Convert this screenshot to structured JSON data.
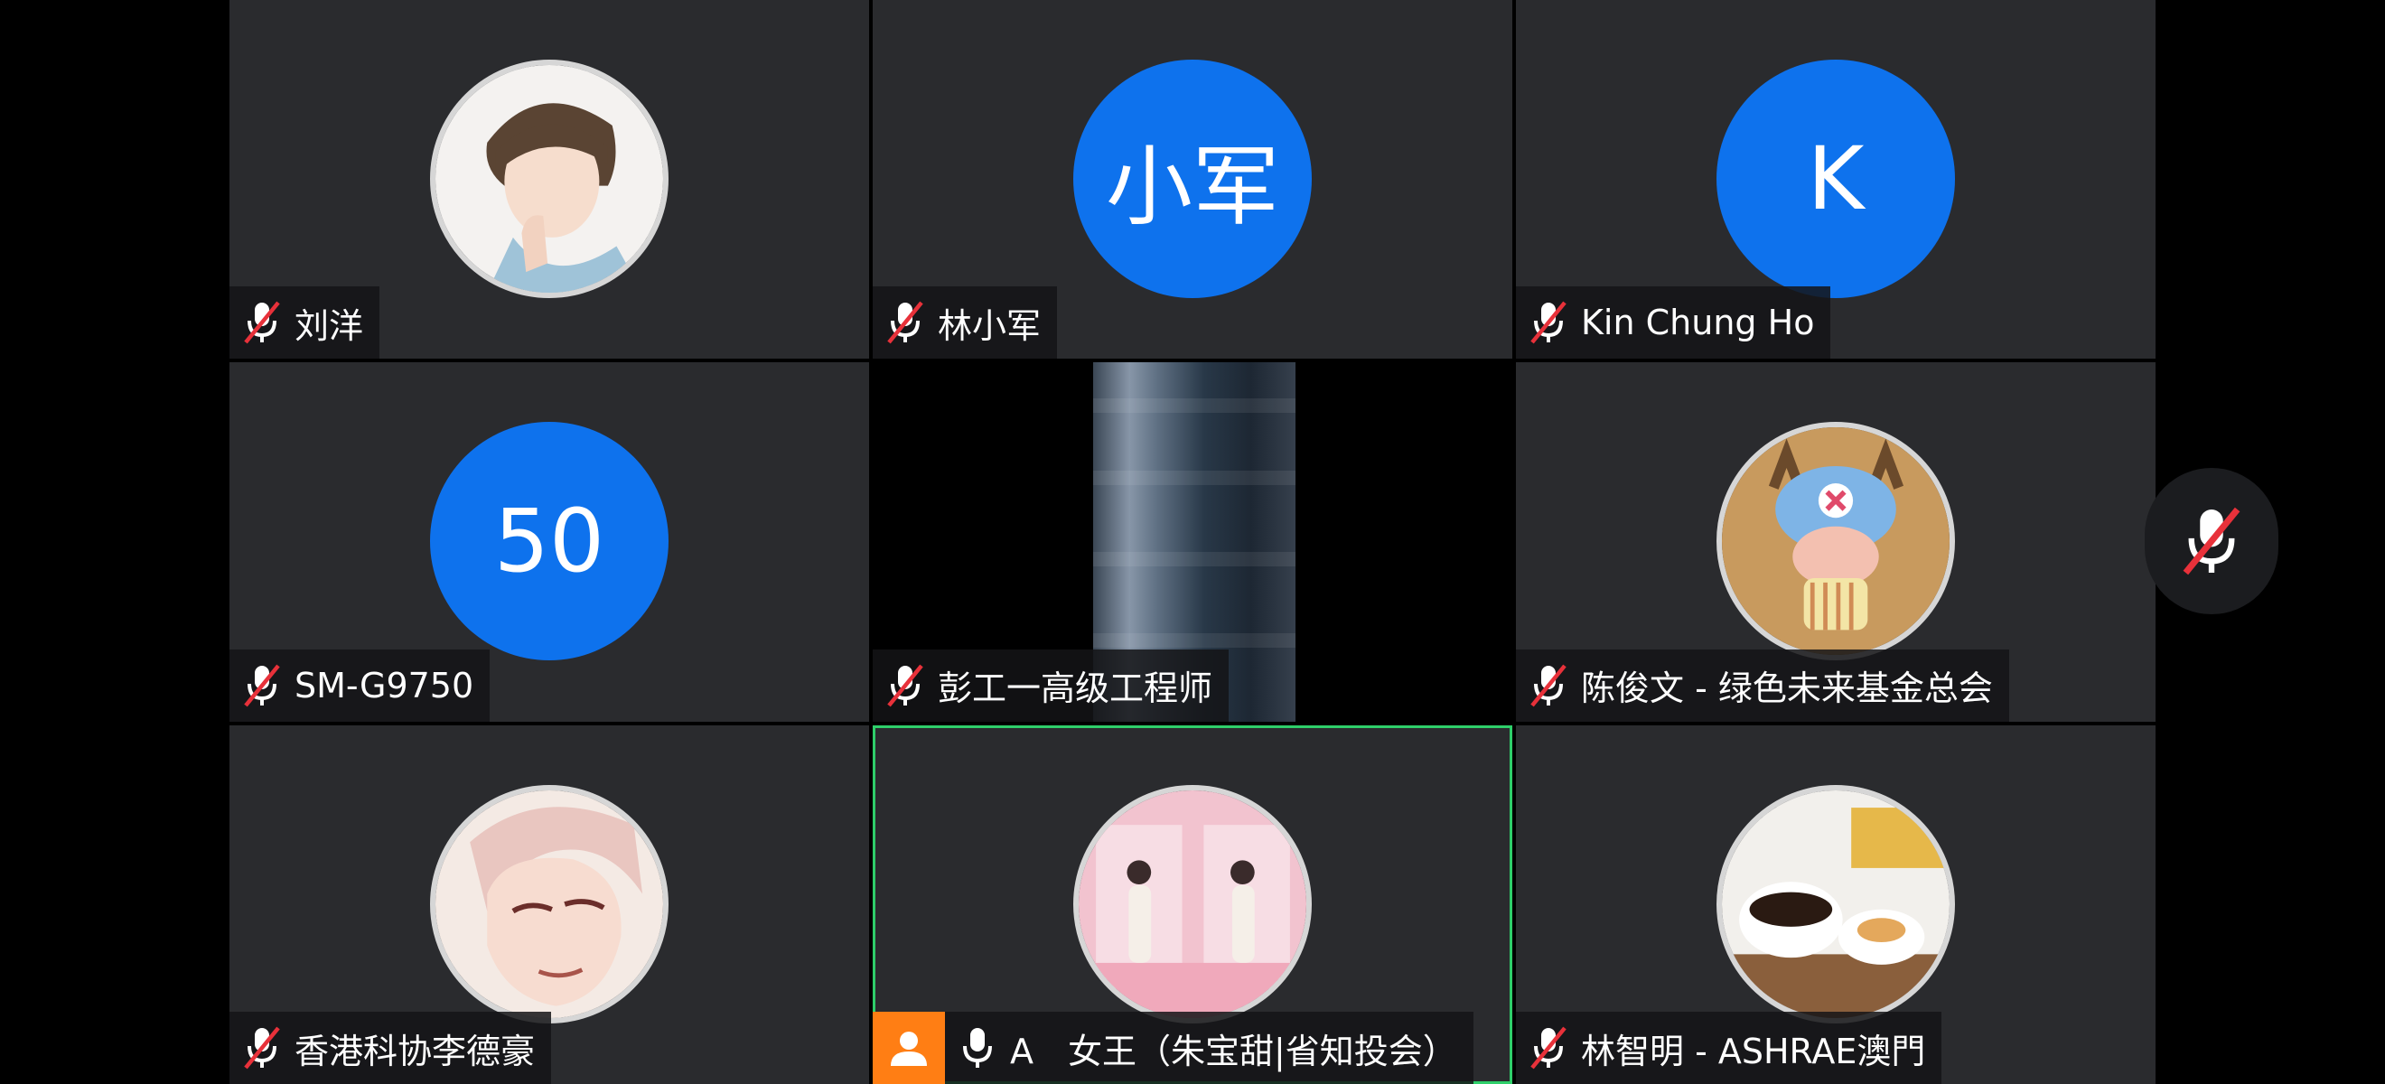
{
  "participants": [
    {
      "name": "刘洋",
      "avatar": "photo-anime-boy",
      "mic": "muted"
    },
    {
      "name": "林小军",
      "avatar_text": "小军",
      "mic": "muted"
    },
    {
      "name": "Kin Chung Ho",
      "avatar_text": "K",
      "mic": "muted"
    },
    {
      "name": "SM-G9750",
      "avatar_text": "50",
      "mic": "muted"
    },
    {
      "name": "彭工一高级工程师",
      "avatar": "video",
      "mic": "muted"
    },
    {
      "name": "陈俊文 - 绿色未来基金总会",
      "avatar": "photo-chopper-figure",
      "mic": "muted"
    },
    {
      "name": "香港科协李德豪",
      "avatar": "photo-anime-man",
      "mic": "muted"
    },
    {
      "name": "A　女王（朱宝甜|省知投会）",
      "avatar": "photo-woman",
      "mic": "unmuted",
      "host": true,
      "active_speaker": true
    },
    {
      "name": "林智明 - ASHRAE澳門",
      "avatar": "photo-coffee",
      "mic": "muted"
    }
  ],
  "colors": {
    "tile_bg": "#2a2b2e",
    "avatar_blue": "#0e72ed",
    "mute_red": "#e8313a",
    "active_border": "#2fcf6a",
    "host_orange": "#ff7e14"
  },
  "controls": {
    "self_mic": {
      "icon": "mic-muted-icon",
      "state": "muted"
    }
  }
}
